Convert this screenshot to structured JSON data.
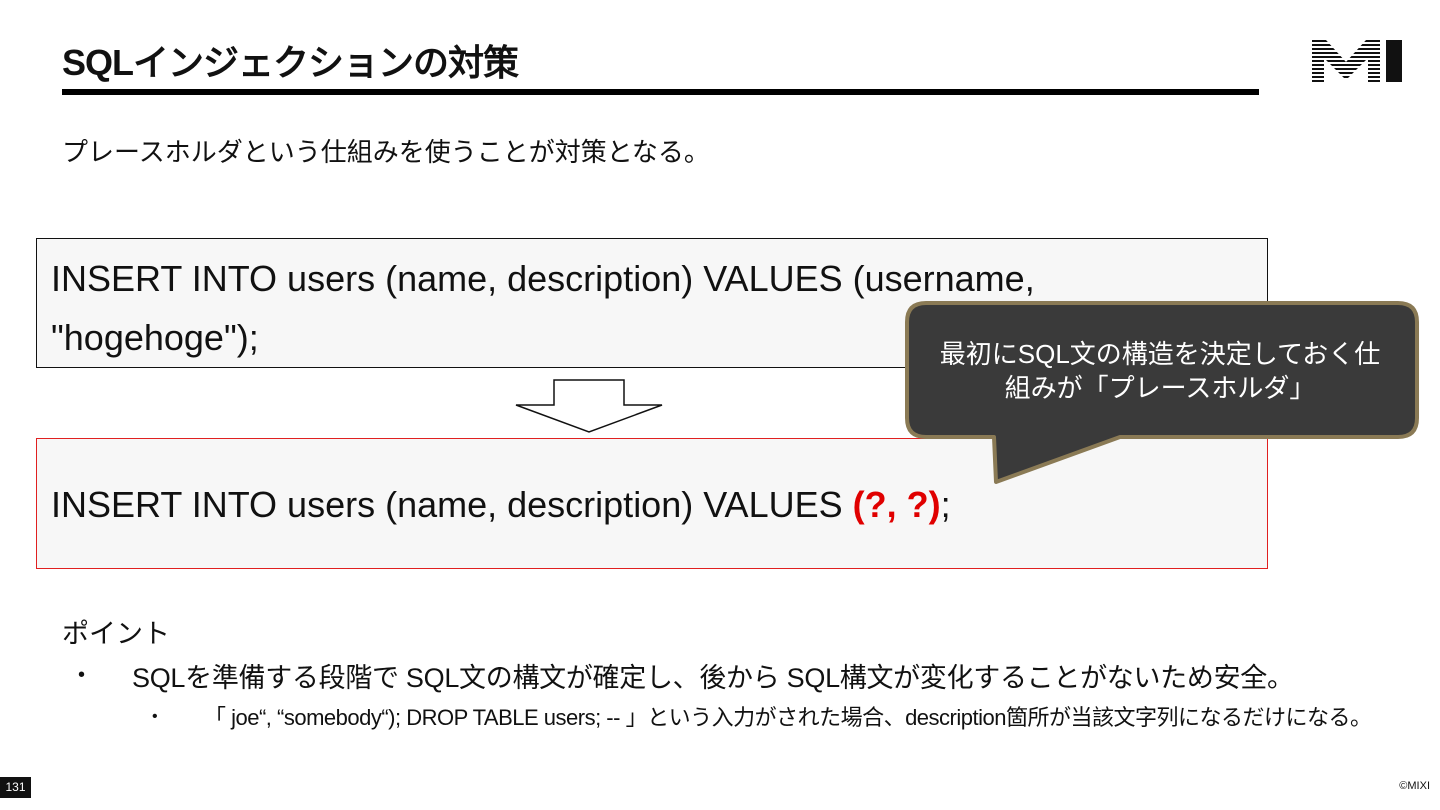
{
  "slide": {
    "title": "SQLインジェクションの対策",
    "subtitle": "プレースホルダという仕組みを使うことが対策となる。",
    "logo_text": "MI"
  },
  "code": {
    "before_line1": "INSERT INTO users (name, description) VALUES (username,",
    "before_line2": "\"hogehoge\");",
    "after_prefix": "INSERT INTO users (name, description) VALUES ",
    "after_placeholder": "(?, ?)",
    "after_suffix": ";"
  },
  "callout": {
    "line1": "最初にSQL文の構造を決定しておく仕",
    "line2": "組みが「プレースホルダ」"
  },
  "points": {
    "heading": "ポイント",
    "bullet_mark": "•",
    "item1": "SQLを準備する段階で SQL文の構文が確定し、後から SQL構文が変化することがないため安全。",
    "subitem1": "「 joe“, “somebody“); DROP TABLE users; -- 」という入力がされた場合、description箇所が当該文字列になるだけになる。"
  },
  "footer": {
    "page_number": "131",
    "copyright": "©MIXI"
  },
  "colors": {
    "accent_red": "#e00000",
    "callout_bg": "#3a3a3a",
    "callout_border": "#8a7a55"
  }
}
